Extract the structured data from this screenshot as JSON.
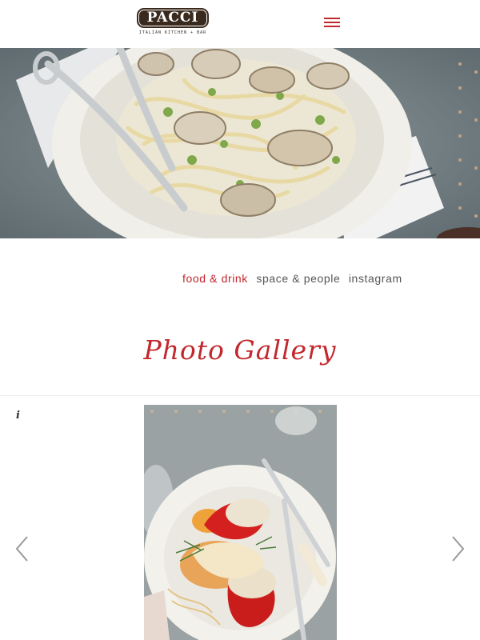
{
  "header": {
    "logo_text": "PACCI",
    "logo_subtext": "ITALIAN KITCHEN + BAR",
    "menu_icon": "hamburger-menu-icon",
    "accent_color": "#c2272d"
  },
  "hero": {
    "alt": "Bowl of linguine with clams"
  },
  "gallery_nav": {
    "items": [
      {
        "label": "food & drink",
        "active": true
      },
      {
        "label": "space & people",
        "active": false
      },
      {
        "label": "instagram",
        "active": false
      }
    ]
  },
  "gallery": {
    "title": "Photo Gallery",
    "info_label": "i",
    "prev_icon": "chevron-left-icon",
    "next_icon": "chevron-right-icon",
    "current_photo": "Stuffed red peppers with fish on a white plate"
  }
}
